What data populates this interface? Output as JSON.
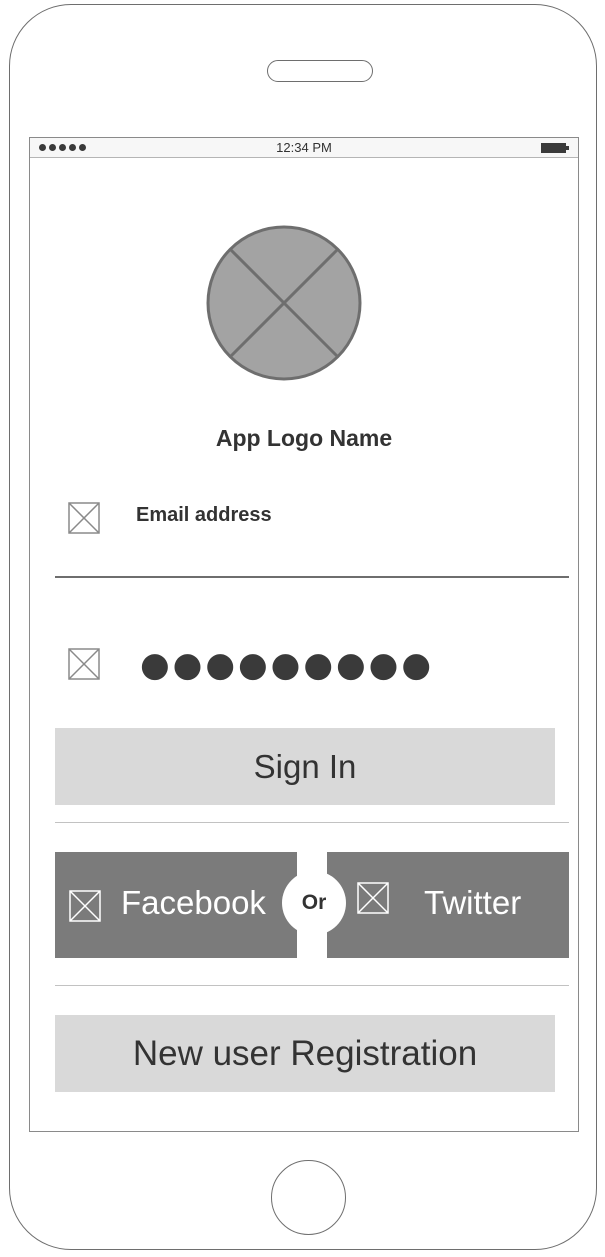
{
  "status_bar": {
    "time": "12:34 PM",
    "signal_dots": 5,
    "icons": {
      "signal": "signal-dots-icon",
      "battery": "battery-icon"
    }
  },
  "app": {
    "logo_icon": "image-placeholder-icon",
    "name": "App Logo Name"
  },
  "form": {
    "email": {
      "icon": "image-placeholder-icon",
      "label": "Email address"
    },
    "password": {
      "icon": "image-placeholder-icon",
      "value": "●●●●●●●●●"
    },
    "sign_in_label": "Sign In"
  },
  "social": {
    "facebook_label": "Facebook",
    "or_label": "Or",
    "twitter_label": "Twitter"
  },
  "register_label": "New user Registration",
  "colors": {
    "outline": "#6e6e6e",
    "button_light": "#d9d9d9",
    "button_dark": "#7b7b7b",
    "text": "#333333"
  }
}
